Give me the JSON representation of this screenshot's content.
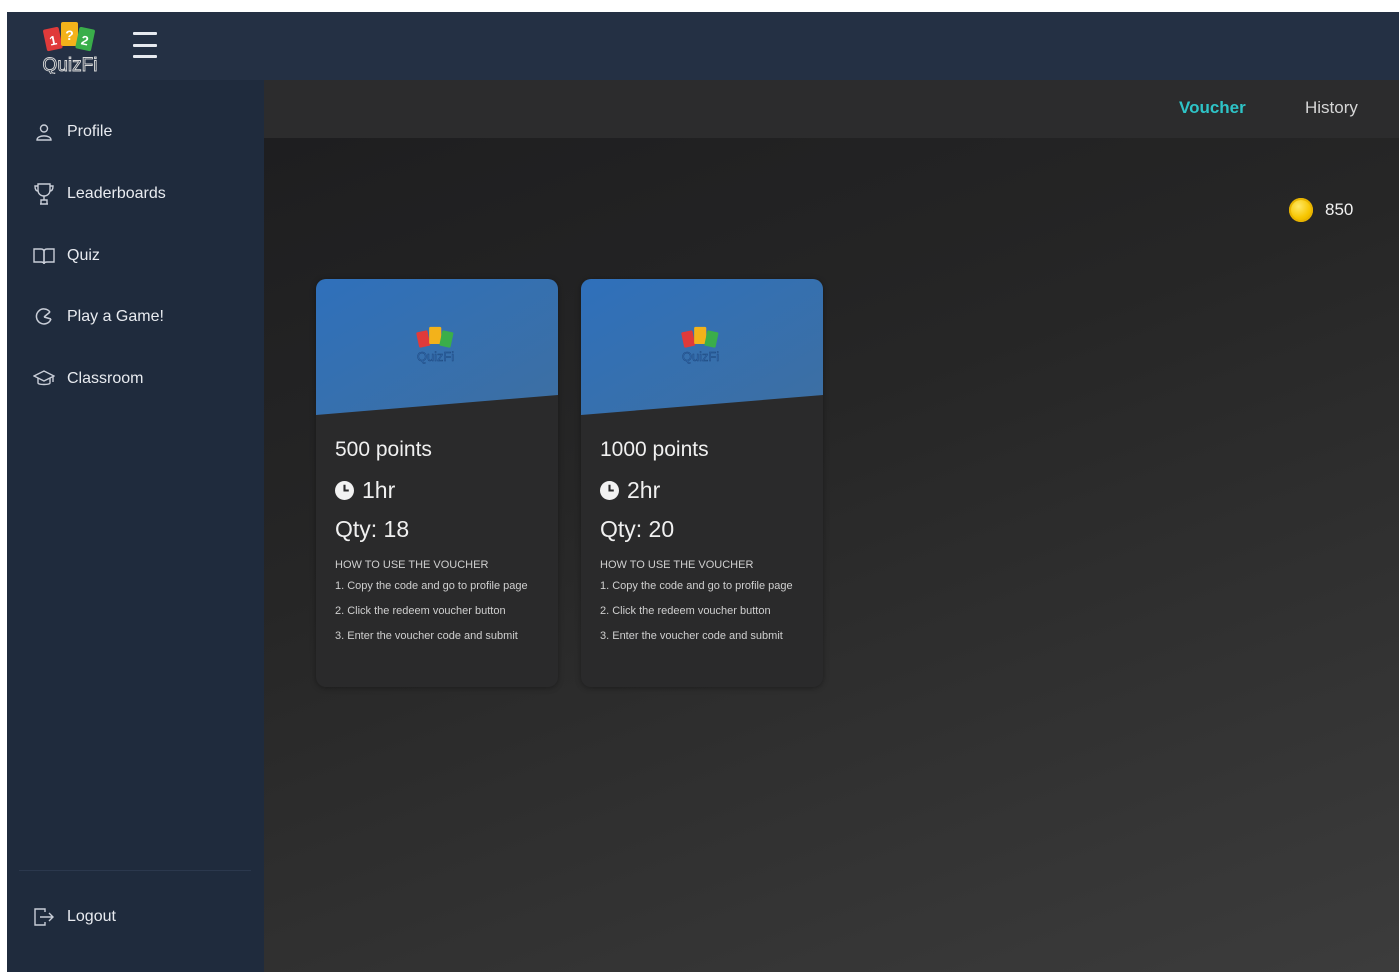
{
  "app": {
    "logo_text": "QuizFi"
  },
  "sidebar": {
    "items": [
      {
        "label": "Profile",
        "icon": "user-icon"
      },
      {
        "label": "Leaderboards",
        "icon": "trophy-icon"
      },
      {
        "label": "Quiz",
        "icon": "book-icon"
      },
      {
        "label": "Play a Game!",
        "icon": "game-icon"
      },
      {
        "label": "Classroom",
        "icon": "graduation-cap-icon"
      }
    ],
    "logout": {
      "label": "Logout",
      "icon": "logout-icon"
    }
  },
  "tabs": [
    {
      "label": "Voucher",
      "active": true
    },
    {
      "label": "History",
      "active": false
    }
  ],
  "user": {
    "points": "850"
  },
  "vouchers": [
    {
      "points": "500 points",
      "duration": "1hr",
      "qty": "Qty: 18",
      "how_title": "HOW TO USE THE VOUCHER",
      "steps": [
        "1. Copy the code and go to profile page",
        "2. Click the redeem voucher button",
        "3. Enter the voucher code and submit"
      ]
    },
    {
      "points": "1000 points",
      "duration": "2hr",
      "qty": "Qty: 20",
      "how_title": "HOW TO USE THE VOUCHER",
      "steps": [
        "1. Copy the code and go to profile page",
        "2. Click the redeem voucher button",
        "3. Enter the voucher code and submit"
      ]
    }
  ],
  "colors": {
    "accent": "#2ec4c7",
    "sidebar": "#1f2b3d",
    "card_banner": "#2f6bb0",
    "coin": "#f7c600"
  }
}
